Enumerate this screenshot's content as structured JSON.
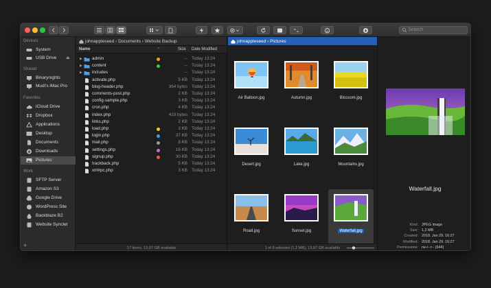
{
  "toolbar": {
    "search_placeholder": "Search",
    "colors": {
      "close": "#fe5f57",
      "minimize": "#febc2e",
      "zoom": "#28c840"
    }
  },
  "sidebar": {
    "sections": [
      {
        "title": "Devices",
        "items": [
          {
            "label": "System",
            "icon": "hard-drive-icon"
          },
          {
            "label": "USB Drive",
            "icon": "usb-drive-icon",
            "eject": "⏏"
          }
        ]
      },
      {
        "title": "Shared",
        "items": [
          {
            "label": "Binarynights",
            "icon": "network-computer-icon"
          },
          {
            "label": "Mudi's iMac Pro",
            "icon": "imac-icon"
          }
        ]
      },
      {
        "title": "Favorites",
        "items": [
          {
            "label": "iCloud Drive",
            "icon": "cloud-icon"
          },
          {
            "label": "Dropbox",
            "icon": "dropbox-icon"
          },
          {
            "label": "Applications",
            "icon": "applications-icon"
          },
          {
            "label": "Desktop",
            "icon": "desktop-icon"
          },
          {
            "label": "Documents",
            "icon": "documents-icon"
          },
          {
            "label": "Downloads",
            "icon": "downloads-icon"
          },
          {
            "label": "Pictures",
            "icon": "pictures-icon",
            "selected": true
          }
        ]
      },
      {
        "title": "Work",
        "items": [
          {
            "label": "SFTP Server",
            "icon": "server-icon"
          },
          {
            "label": "Amazon S3",
            "icon": "server-icon"
          },
          {
            "label": "Google Drive",
            "icon": "google-drive-icon"
          },
          {
            "label": "WordPress Site",
            "icon": "wordpress-icon"
          },
          {
            "label": "Backblaze B2",
            "icon": "backblaze-icon"
          },
          {
            "label": "Website Synclet",
            "icon": "sync-icon"
          }
        ]
      }
    ]
  },
  "left_pane": {
    "path": [
      "johnappleseed",
      "Documents",
      "Website Backup"
    ],
    "columns": {
      "name": "Name",
      "size": "Size",
      "date": "Date Modified"
    },
    "rows": [
      {
        "name": "admin",
        "folder": true,
        "size": "--",
        "date": "Today 13:24",
        "tag": "#f0a030"
      },
      {
        "name": "content",
        "folder": true,
        "size": "--",
        "date": "Today 13:24",
        "tag": "#3cc84a"
      },
      {
        "name": "includes",
        "folder": true,
        "size": "--",
        "date": "Today 13:24",
        "tag": ""
      },
      {
        "name": "activate.php",
        "size": "5 KB",
        "date": "Today 13:24",
        "tag": ""
      },
      {
        "name": "blog-header.php",
        "size": "364 bytes",
        "date": "Today 13:24",
        "tag": ""
      },
      {
        "name": "comments-post.php",
        "size": "2 KB",
        "date": "Today 13:24",
        "tag": ""
      },
      {
        "name": "config-sample.php",
        "size": "3 KB",
        "date": "Today 13:24",
        "tag": ""
      },
      {
        "name": "cron.php",
        "size": "4 KB",
        "date": "Today 13:24",
        "tag": ""
      },
      {
        "name": "index.php",
        "size": "418 bytes",
        "date": "Today 13:24",
        "tag": ""
      },
      {
        "name": "links.php",
        "size": "2 KB",
        "date": "Today 13:24",
        "tag": ""
      },
      {
        "name": "load.php",
        "size": "3 KB",
        "date": "Today 13:24",
        "tag": "#f2c81e"
      },
      {
        "name": "login.php",
        "size": "37 KB",
        "date": "Today 13:24",
        "tag": "#3aa0f0"
      },
      {
        "name": "mail.php",
        "size": "8 KB",
        "date": "Today 13:24",
        "tag": "#9a9a9a"
      },
      {
        "name": "settings.php",
        "size": "16 KB",
        "date": "Today 13:24",
        "tag": "#c070e0"
      },
      {
        "name": "signup.php",
        "size": "30 KB",
        "date": "Today 13:24",
        "tag": "#f05a3c"
      },
      {
        "name": "trackback.php",
        "size": "5 KB",
        "date": "Today 13:24",
        "tag": ""
      },
      {
        "name": "xmlrpc.php",
        "size": "3 KB",
        "date": "Today 13:24",
        "tag": ""
      }
    ],
    "status": "17 items, 13,97 GB available"
  },
  "right_pane": {
    "path": [
      "johnappleseed",
      "Pictures"
    ],
    "items": [
      {
        "name": "Air Balloon.jpg",
        "icon": "air-balloon-thumbnail"
      },
      {
        "name": "Autumn.jpg",
        "icon": "autumn-thumbnail"
      },
      {
        "name": "Blossom.jpg",
        "icon": "blossom-thumbnail"
      },
      {
        "name": "Desert.jpg",
        "icon": "desert-thumbnail"
      },
      {
        "name": "Lake.jpg",
        "icon": "lake-thumbnail"
      },
      {
        "name": "Mountains.jpg",
        "icon": "mountains-thumbnail"
      },
      {
        "name": "Road.jpg",
        "icon": "road-thumbnail"
      },
      {
        "name": "Sunset.jpg",
        "icon": "sunset-thumbnail"
      },
      {
        "name": "Waterfall.jpg",
        "icon": "waterfall-thumbnail",
        "selected": true
      }
    ],
    "status": "1 of 9 selected (1,2 MB), 13,97 GB available"
  },
  "preview": {
    "name": "Waterfall.jpg",
    "meta": [
      {
        "k": "Kind:",
        "v": "JPEG image"
      },
      {
        "k": "Size:",
        "v": "1,2 MB"
      },
      {
        "k": "Created:",
        "v": "2018. Jan 29. 16:27"
      },
      {
        "k": "Modified:",
        "v": "2018. Jan 29. 16:27"
      },
      {
        "k": "Permissions:",
        "v": "rw-r--r-- (644)"
      },
      {
        "k": "Owner:",
        "v": "johnappleseed"
      },
      {
        "k": "Group:",
        "v": "staff"
      },
      {
        "k": "Dimensions:",
        "v": "2200 x 1331"
      }
    ]
  }
}
